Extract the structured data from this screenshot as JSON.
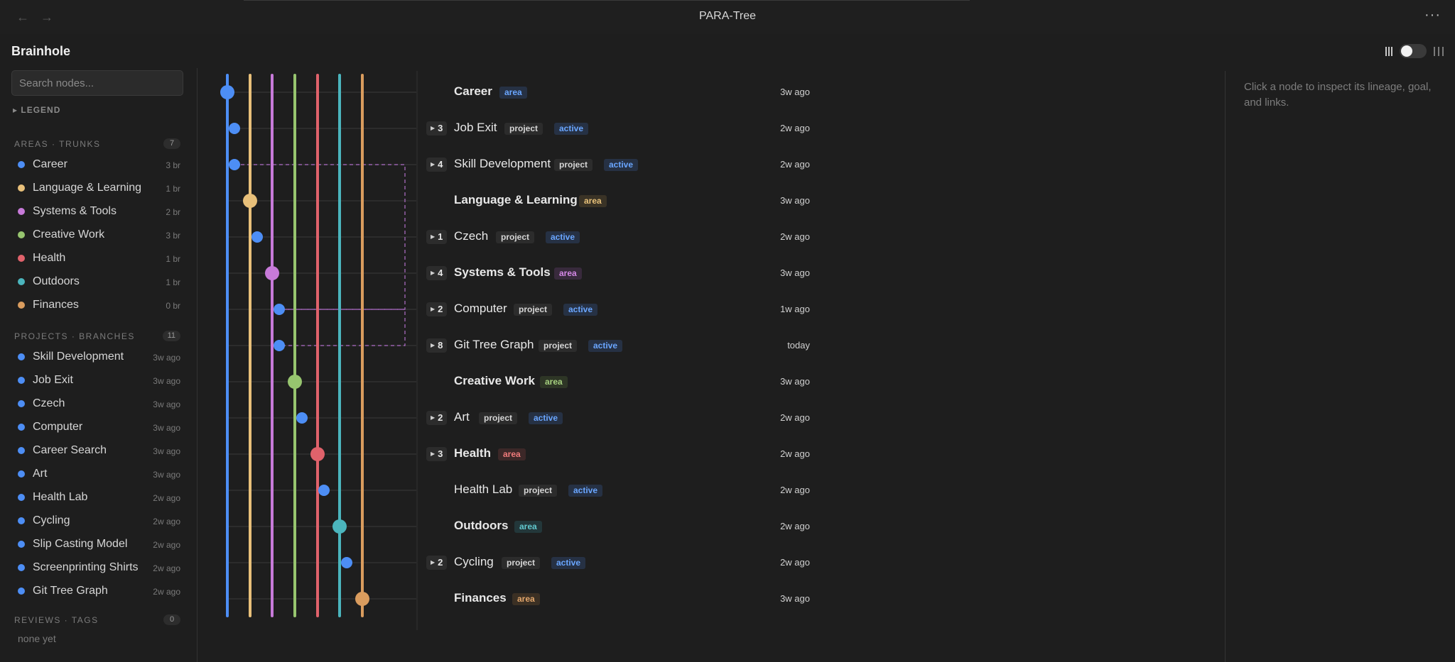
{
  "window": {
    "title": "PARA-Tree",
    "back_icon": "arrow-left-icon",
    "forward_icon": "arrow-right-icon",
    "more_label": "···"
  },
  "app": {
    "name": "Brainhole"
  },
  "search": {
    "placeholder": "Search nodes...",
    "value": ""
  },
  "legend": {
    "label": "▸ LEGEND"
  },
  "sections": {
    "areas": {
      "title": "AREAS · TRUNKS",
      "count": "7"
    },
    "projects": {
      "title": "PROJECTS · BRANCHES",
      "count": "11"
    },
    "reviews": {
      "title": "REVIEWS · TAGS",
      "count": "0",
      "empty": "none yet"
    }
  },
  "areas": [
    {
      "label": "Career",
      "meta": "3 br",
      "color": "#4d8ef5"
    },
    {
      "label": "Language & Learning",
      "meta": "1 br",
      "color": "#e8c07a"
    },
    {
      "label": "Systems & Tools",
      "meta": "2 br",
      "color": "#c77ad9"
    },
    {
      "label": "Creative Work",
      "meta": "3 br",
      "color": "#97c56f"
    },
    {
      "label": "Health",
      "meta": "1 br",
      "color": "#e0626b"
    },
    {
      "label": "Outdoors",
      "meta": "1 br",
      "color": "#4bb5bd"
    },
    {
      "label": "Finances",
      "meta": "0 br",
      "color": "#d99c5e"
    }
  ],
  "projects": [
    {
      "label": "Skill Development",
      "meta": "3w ago"
    },
    {
      "label": "Job Exit",
      "meta": "3w ago"
    },
    {
      "label": "Czech",
      "meta": "3w ago"
    },
    {
      "label": "Computer",
      "meta": "3w ago"
    },
    {
      "label": "Career Search",
      "meta": "3w ago"
    },
    {
      "label": "Art",
      "meta": "3w ago"
    },
    {
      "label": "Health Lab",
      "meta": "2w ago"
    },
    {
      "label": "Cycling",
      "meta": "2w ago"
    },
    {
      "label": "Slip Casting Model",
      "meta": "2w ago"
    },
    {
      "label": "Screenprinting Shirts",
      "meta": "2w ago"
    },
    {
      "label": "Git Tree Graph",
      "meta": "2w ago"
    }
  ],
  "project_color": "#4d8ef5",
  "tree_rows": [
    {
      "label": "Career",
      "kind": "area",
      "color": "area-blue",
      "count": "",
      "status": "",
      "time": "3w ago"
    },
    {
      "label": "Job Exit",
      "kind": "project",
      "color": "",
      "count": "3",
      "status": "active",
      "time": "2w ago"
    },
    {
      "label": "Skill Development",
      "kind": "project",
      "color": "",
      "count": "4",
      "status": "active",
      "time": "2w ago"
    },
    {
      "label": "Language & Learning",
      "kind": "area",
      "color": "area-yellow",
      "count": "",
      "status": "",
      "time": "3w ago"
    },
    {
      "label": "Czech",
      "kind": "project",
      "color": "",
      "count": "1",
      "status": "active",
      "time": "2w ago"
    },
    {
      "label": "Systems & Tools",
      "kind": "area",
      "color": "area-purple",
      "count": "4",
      "status": "",
      "time": "3w ago"
    },
    {
      "label": "Computer",
      "kind": "project",
      "color": "",
      "count": "2",
      "status": "active",
      "time": "1w ago"
    },
    {
      "label": "Git Tree Graph",
      "kind": "project",
      "color": "",
      "count": "8",
      "status": "active",
      "time": "today"
    },
    {
      "label": "Creative Work",
      "kind": "area",
      "color": "area-green",
      "count": "",
      "status": "",
      "time": "3w ago"
    },
    {
      "label": "Art",
      "kind": "project",
      "color": "",
      "count": "2",
      "status": "active",
      "time": "2w ago"
    },
    {
      "label": "Health",
      "kind": "area",
      "color": "area-red",
      "count": "3",
      "status": "",
      "time": "2w ago"
    },
    {
      "label": "Health Lab",
      "kind": "project",
      "color": "",
      "count": "",
      "status": "active",
      "time": "2w ago"
    },
    {
      "label": "Outdoors",
      "kind": "area",
      "color": "area-teal",
      "count": "",
      "status": "",
      "time": "2w ago"
    },
    {
      "label": "Cycling",
      "kind": "project",
      "color": "",
      "count": "2",
      "status": "active",
      "time": "2w ago"
    },
    {
      "label": "Finances",
      "kind": "area",
      "color": "area-orange",
      "count": "",
      "status": "",
      "time": "3w ago"
    }
  ],
  "inspector": {
    "hint": "Click a node to inspect its lineage, goal, and links."
  }
}
